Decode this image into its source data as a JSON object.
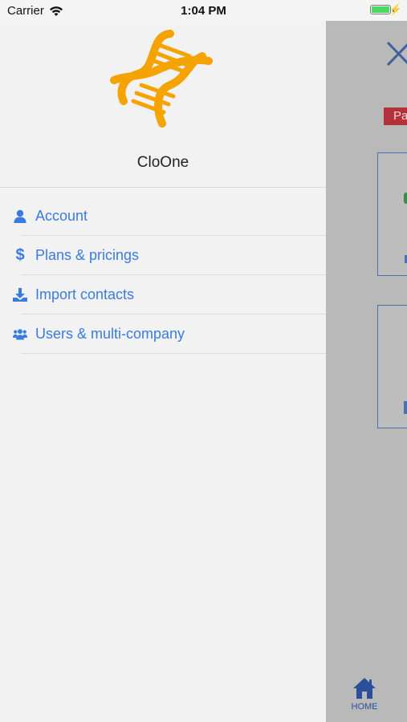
{
  "status_bar": {
    "carrier": "Carrier",
    "time": "1:04 PM"
  },
  "drawer": {
    "app_name": "CloOne",
    "menu": [
      {
        "label": "Account",
        "icon": "user-icon"
      },
      {
        "label": "Plans & pricings",
        "icon": "dollar-icon"
      },
      {
        "label": "Import contacts",
        "icon": "download-icon"
      },
      {
        "label": "Users & multi-company",
        "icon": "users-icon"
      }
    ]
  },
  "background": {
    "badge_text": "Pa",
    "tab_home_label": "HOME"
  },
  "colors": {
    "accent": "#3a7be0",
    "logo": "#f5a300",
    "badge": "#b43139",
    "tab": "#2c4f9a"
  }
}
